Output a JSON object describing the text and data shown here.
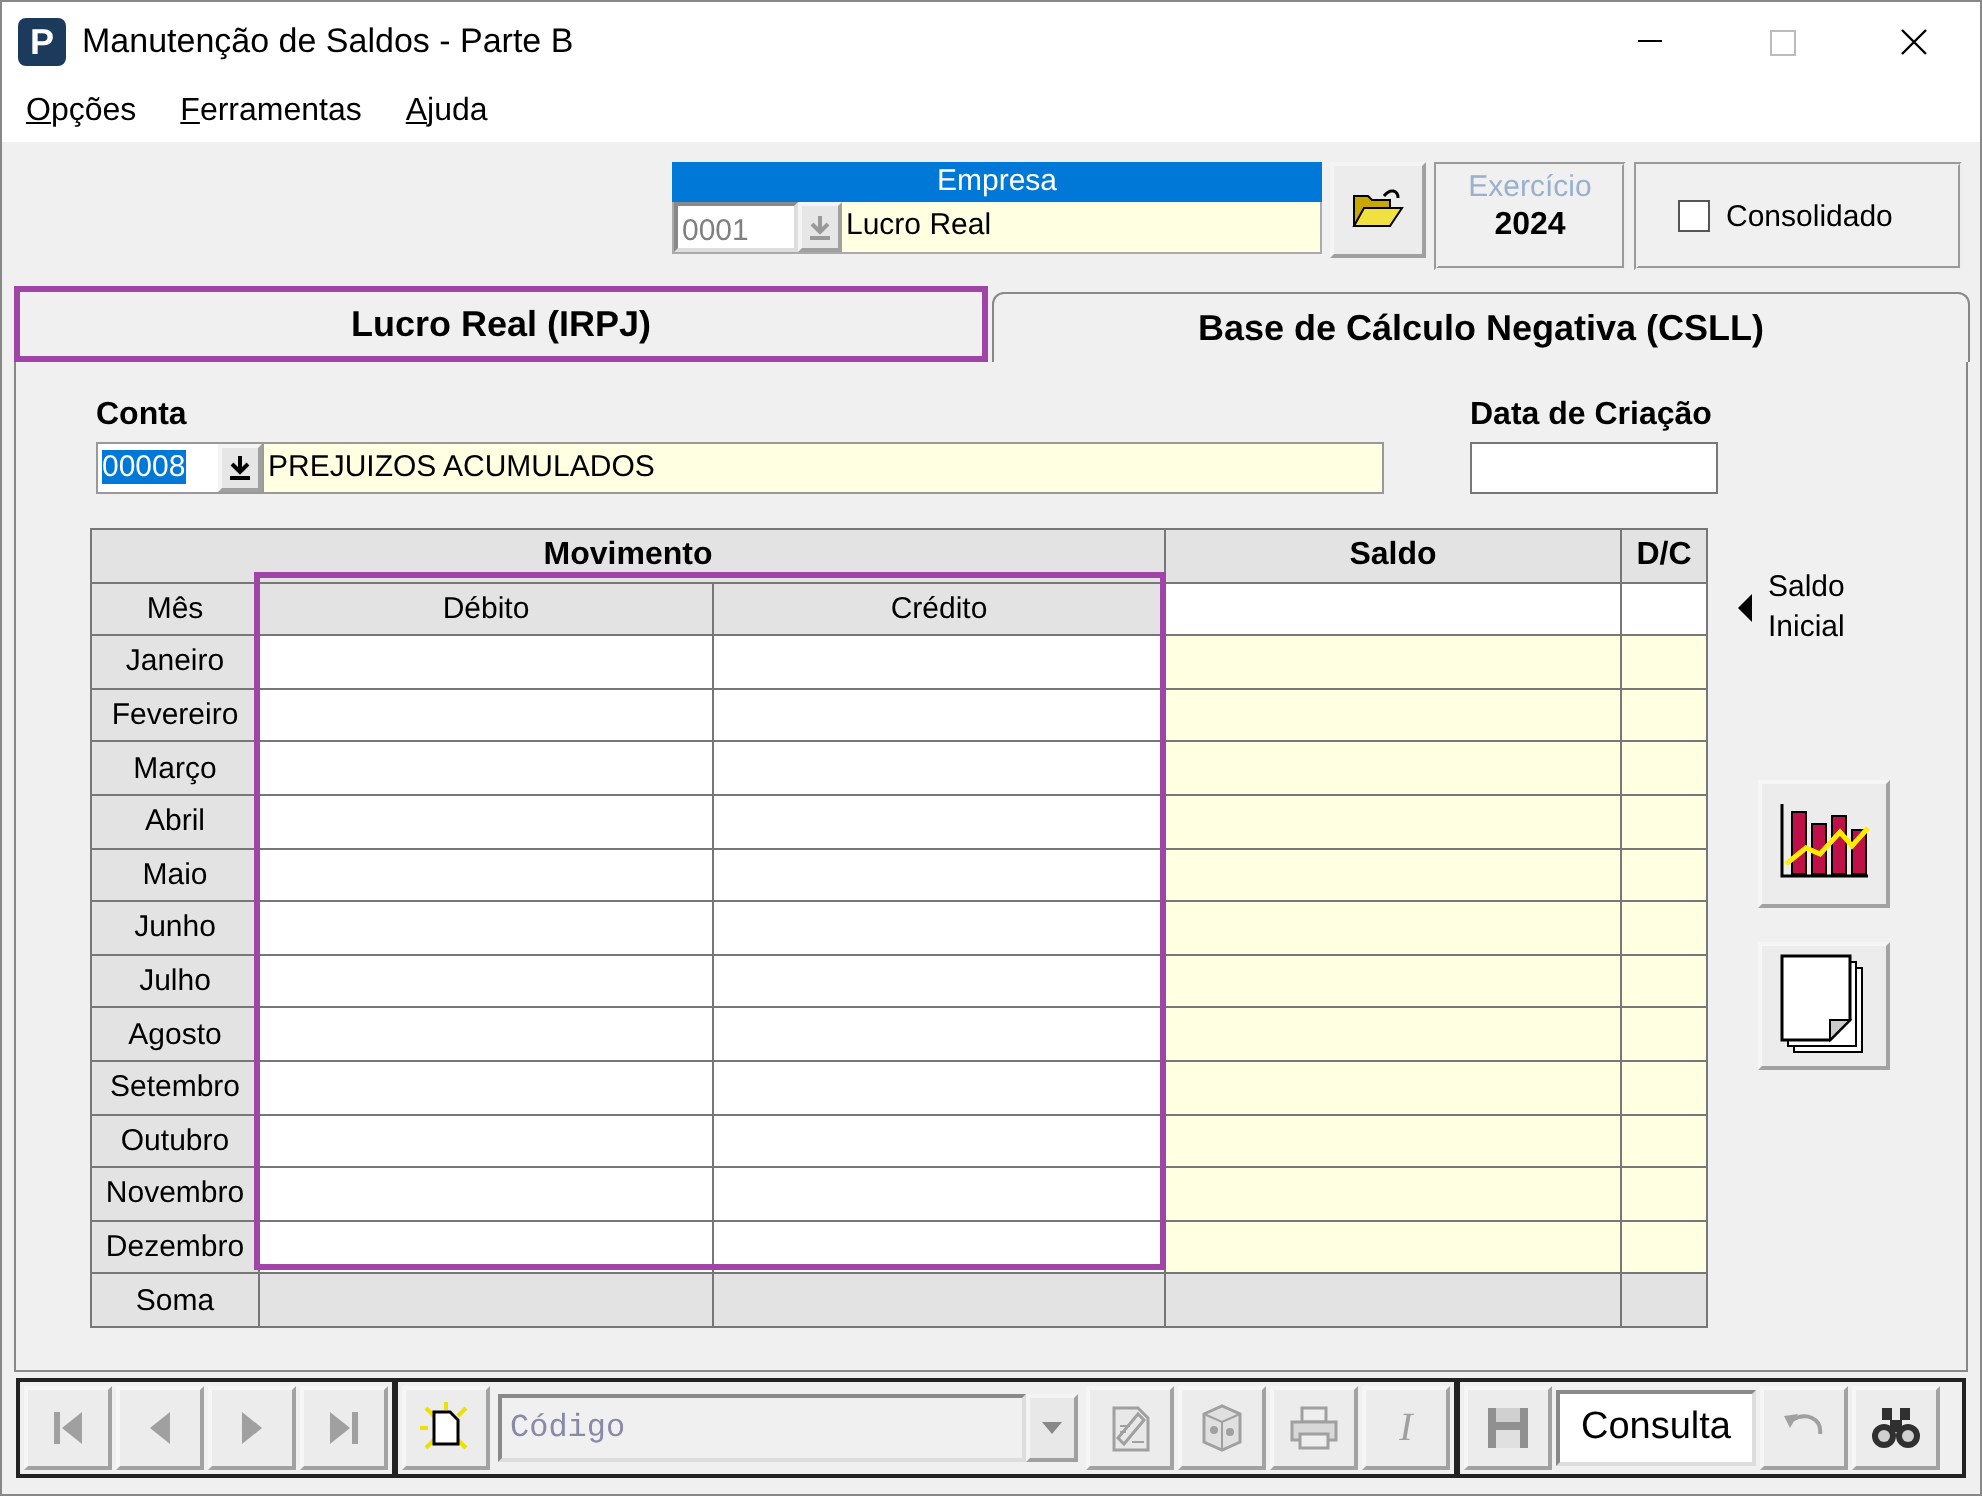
{
  "window": {
    "title": "Manutenção de Saldos - Parte B",
    "logo_letter": "P"
  },
  "menu": [
    {
      "label": "Opções"
    },
    {
      "label": "Ferramentas"
    },
    {
      "label": "Ajuda"
    }
  ],
  "empresa": {
    "label": "Empresa",
    "code": "0001",
    "name": "Lucro Real"
  },
  "exercicio": {
    "label": "Exercício",
    "year": "2024"
  },
  "consolidado": {
    "label": "Consolidado",
    "checked": false
  },
  "tabs": [
    {
      "label": "Lucro Real (IRPJ)",
      "selected": true
    },
    {
      "label": "Base de Cálculo Negativa (CSLL)",
      "selected": false
    }
  ],
  "conta": {
    "label": "Conta",
    "code": "00008",
    "code_selected": true,
    "name": "PREJUIZOS ACUMULADOS"
  },
  "data_criacao": {
    "label": "Data de Criação"
  },
  "grid": {
    "group_header": "Movimento",
    "saldo_header": "Saldo",
    "dc_header": "D/C",
    "columns": [
      "Mês",
      "Débito",
      "Crédito"
    ],
    "rows": [
      {
        "month": "Janeiro"
      },
      {
        "month": "Fevereiro"
      },
      {
        "month": "Março"
      },
      {
        "month": "Abril"
      },
      {
        "month": "Maio"
      },
      {
        "month": "Junho"
      },
      {
        "month": "Julho"
      },
      {
        "month": "Agosto"
      },
      {
        "month": "Setembro"
      },
      {
        "month": "Outubro"
      },
      {
        "month": "Novembro"
      },
      {
        "month": "Dezembro"
      }
    ],
    "total_label": "Soma"
  },
  "saldo_inicial": "Saldo Inicial",
  "toolbar": {
    "nav": [
      {
        "kind": "first",
        "disabled": true
      },
      {
        "kind": "prev",
        "disabled": true
      },
      {
        "kind": "next",
        "disabled": true
      },
      {
        "kind": "last",
        "disabled": true
      }
    ],
    "search_placeholder": "Código",
    "tools": [
      {
        "kind": "edit",
        "disabled": true
      },
      {
        "kind": "delete",
        "disabled": true
      },
      {
        "kind": "print",
        "disabled": true
      },
      {
        "kind": "text",
        "label": "I",
        "disabled": true
      }
    ],
    "mode": "Consulta",
    "actions": [
      {
        "kind": "undo",
        "disabled": true
      },
      {
        "kind": "find",
        "disabled": false
      }
    ]
  }
}
